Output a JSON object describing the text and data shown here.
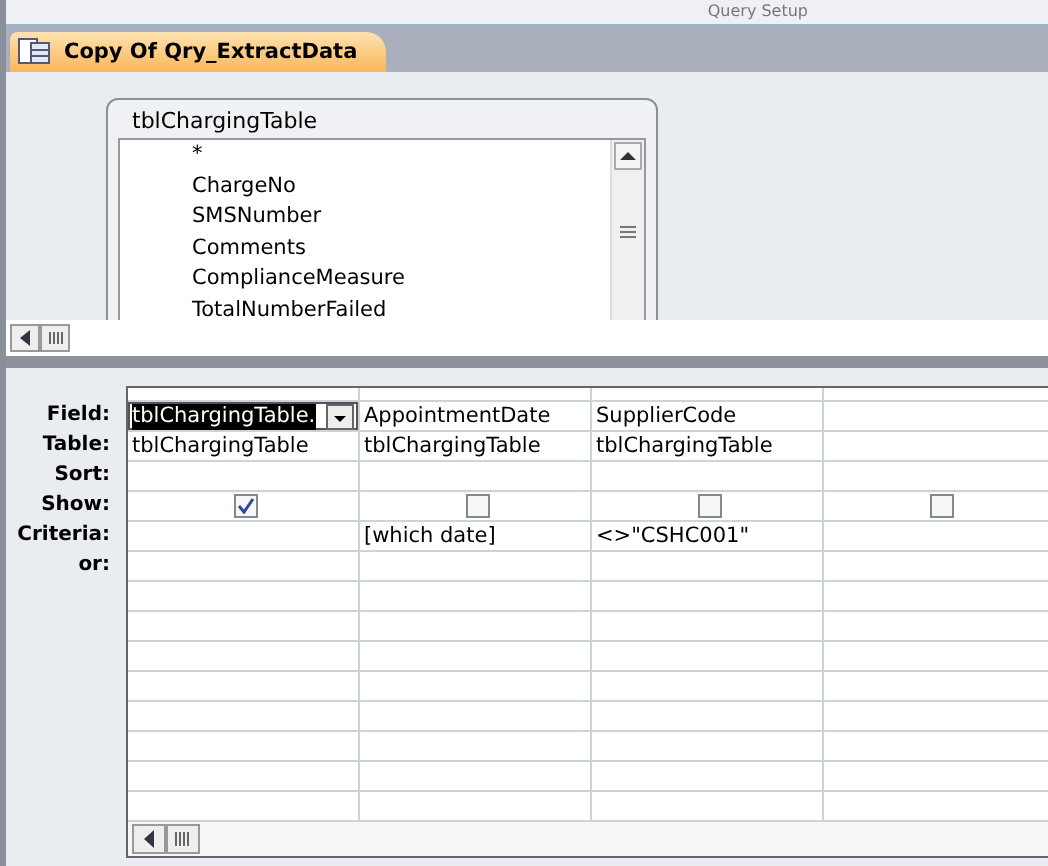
{
  "ribbon": {
    "group_label": "Query Setup"
  },
  "document_tab": {
    "title": "Copy Of Qry_ExtractData",
    "selected": true
  },
  "field_list": {
    "title": "tblChargingTable",
    "fields": [
      "*",
      "ChargeNo",
      "SMSNumber",
      "Comments",
      "ComplianceMeasure",
      "TotalNumberFailed"
    ]
  },
  "grid": {
    "row_labels": [
      "Field:",
      "Table:",
      "Sort:",
      "Show:",
      "Criteria:",
      "or:"
    ],
    "columns": [
      {
        "field": "tblChargingTable.",
        "table": "tblChargingTable",
        "show": true,
        "selected": true
      },
      {
        "field": "AppointmentDate",
        "table": "tblChargingTable",
        "show": false,
        "criteria": "[which date]",
        "selected": false
      },
      {
        "field": "SupplierCode",
        "table": "tblChargingTable",
        "show": false,
        "criteria": "<>\"CSHC001\"",
        "selected": false
      },
      {
        "show": false,
        "selected": false
      }
    ]
  }
}
